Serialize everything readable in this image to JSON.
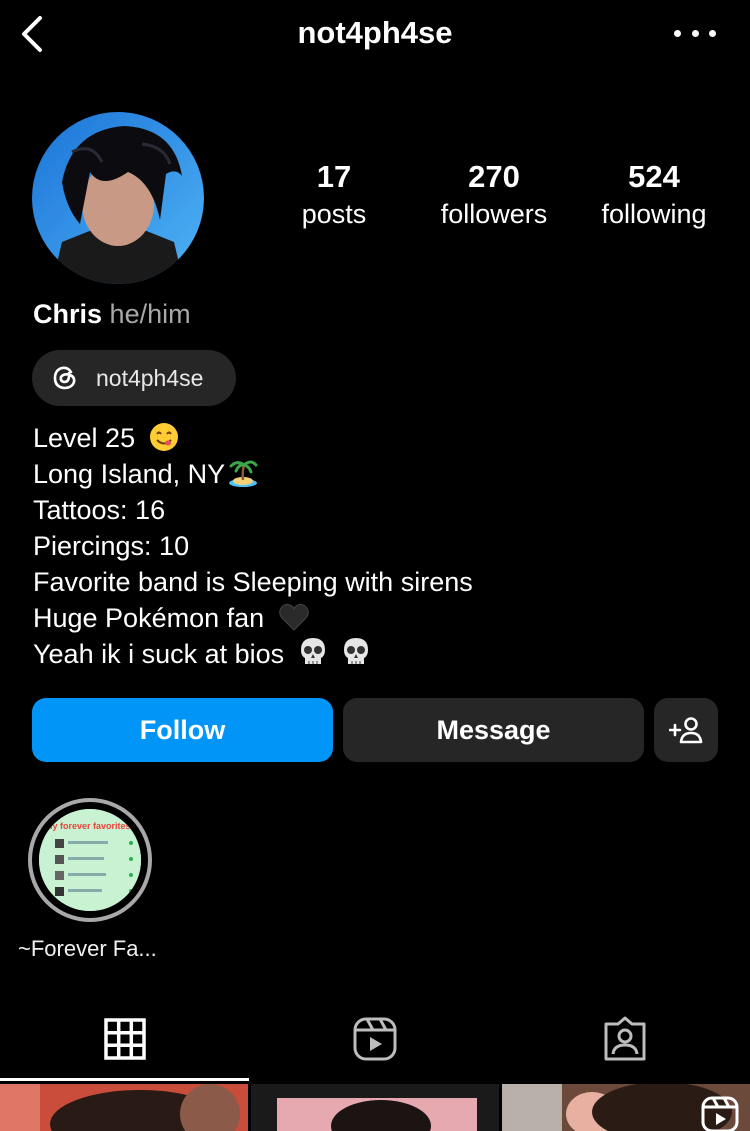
{
  "header": {
    "username": "not4ph4se"
  },
  "stats": [
    {
      "value": "17",
      "label": "posts"
    },
    {
      "value": "270",
      "label": "followers"
    },
    {
      "value": "524",
      "label": "following"
    }
  ],
  "profile": {
    "name": "Chris",
    "pronouns": "he/him"
  },
  "threads_badge": {
    "handle": "not4ph4se",
    "icon": "threads-icon"
  },
  "bio": {
    "lines": [
      "Level 25",
      "Long Island, NY",
      "Tattoos: 16",
      "Piercings: 10",
      "Favorite band is Sleeping with sirens",
      "Huge Pokémon fan",
      "Yeah ik i suck at bios"
    ]
  },
  "buttons": {
    "follow": "Follow",
    "message": "Message"
  },
  "highlights": [
    {
      "label": "~Forever Fa...",
      "cover_heading": "My forever favorites"
    }
  ],
  "tabs": [
    "grid-icon",
    "reels-icon",
    "tagged-icon"
  ],
  "colors": {
    "accent": "#0095f6",
    "button_dark": "#262626",
    "background": "#000000"
  }
}
